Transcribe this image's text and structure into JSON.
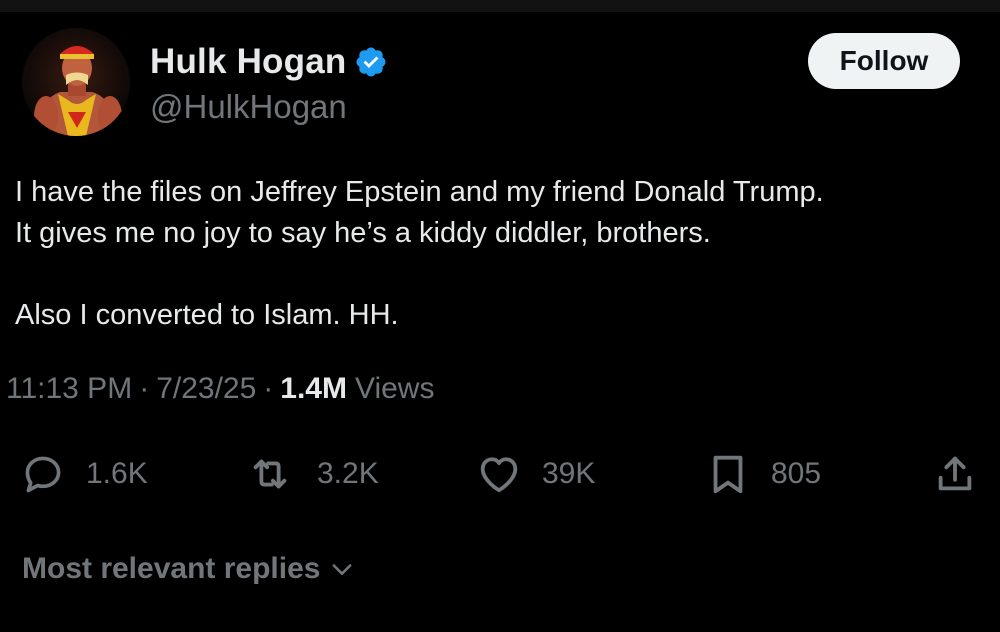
{
  "author": {
    "display_name": "Hulk Hogan",
    "handle": "@HulkHogan",
    "verified_icon": "verified-badge-icon",
    "avatar_icon": "profile-photo"
  },
  "follow_button": {
    "label": "Follow"
  },
  "tweet": {
    "lines": [
      "I have the files on Jeffrey Epstein and my friend Donald Trump.",
      "It gives me no joy to say he’s a kiddy diddler, brothers.",
      "Also I converted to Islam. HH."
    ]
  },
  "meta": {
    "time": "11:13 PM",
    "date": "7/23/25",
    "separator": "·",
    "views_count": "1.4M",
    "views_label": "Views"
  },
  "actions": {
    "reply": {
      "icon": "reply-icon",
      "count": "1.6K"
    },
    "repost": {
      "icon": "repost-icon",
      "count": "3.2K"
    },
    "like": {
      "icon": "heart-icon",
      "count": "39K"
    },
    "bookmark": {
      "icon": "bookmark-icon",
      "count": "805"
    },
    "share": {
      "icon": "share-icon"
    }
  },
  "replies_filter": {
    "label": "Most relevant replies",
    "icon": "chevron-down-icon"
  },
  "colors": {
    "background": "#000000",
    "primary_text": "#e7e9ea",
    "secondary_text": "#71767b",
    "verified_blue": "#1d9bf0",
    "follow_button_bg": "#eff3f4",
    "follow_button_text": "#0f1419"
  }
}
